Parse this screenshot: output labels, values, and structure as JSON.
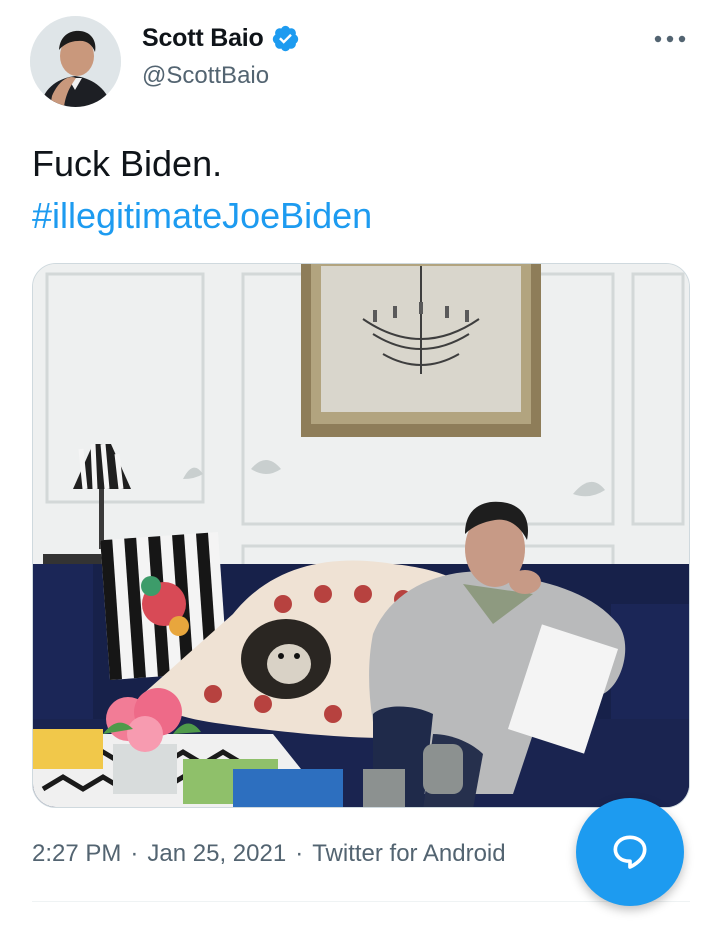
{
  "author": {
    "display_name": "Scott Baio",
    "handle": "@ScottBaio",
    "verified": true,
    "avatar_icon": "profile-photo"
  },
  "tweet": {
    "text_line1": "Fuck Biden.",
    "hashtag": "#illegitimateJoeBiden"
  },
  "media": {
    "kind": "photo"
  },
  "meta": {
    "time": "2:27 PM",
    "date": "Jan 25, 2021",
    "separator": "·",
    "source": "Twitter for Android"
  },
  "actions": {
    "more_icon": "more-horizontal-icon",
    "compose_icon": "reply-bubble-icon"
  },
  "colors": {
    "accent": "#1d9bf0",
    "text": "#0f1419",
    "secondary": "#536471"
  }
}
